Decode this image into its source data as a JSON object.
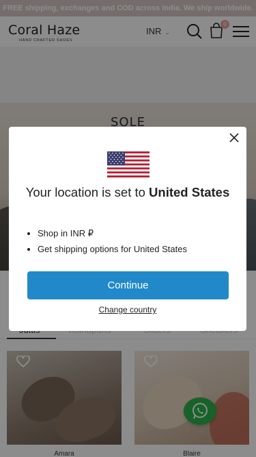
{
  "announcement": "FREE shipping, exchanges and COD across India. We ship worldwide.",
  "header": {
    "brand_name": "Coral Haze",
    "brand_tagline": "HAND CRAFTED SHOES",
    "currency": "INR",
    "cart_count": "0"
  },
  "hero": {
    "text": "SOLE"
  },
  "tabs": [
    "Juttis",
    "Kolhapuris",
    "Sliders",
    "Sneakers"
  ],
  "products": [
    {
      "name": "Amara"
    },
    {
      "name": "Blaire"
    }
  ],
  "modal": {
    "title_prefix": "Your location is set to",
    "country": "United States",
    "bullets": [
      "Shop in INR ₽",
      "Get shipping options for United States"
    ],
    "continue_label": "Continue",
    "change_label": "Change country"
  },
  "colors": {
    "accent": "#2189c9",
    "announcement_bg": "#d6c6c4",
    "whatsapp": "#2bb24a"
  }
}
